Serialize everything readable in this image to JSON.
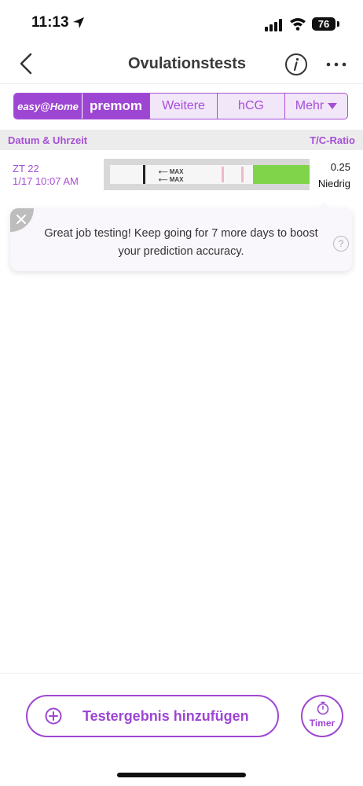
{
  "status_bar": {
    "time": "11:13",
    "battery": "76"
  },
  "nav": {
    "title": "Ovulationstests"
  },
  "brand_tabs": [
    {
      "label": "easy@Home"
    },
    {
      "label": "premom"
    },
    {
      "label": "Weitere"
    },
    {
      "label": "hCG"
    },
    {
      "label": "Mehr"
    }
  ],
  "table": {
    "header_left": "Datum & Uhrzeit",
    "header_right": "T/C-Ratio",
    "rows": [
      {
        "cycle_day": "ZT 22",
        "datetime": "1/17 10:07 AM",
        "ratio": "0.25",
        "level": "Niedrig",
        "strip_text_1": "MAX",
        "strip_text_2": "MAX"
      }
    ]
  },
  "tip": {
    "text": "Great job testing! Keep going for 7 more days to boost your prediction accuracy.",
    "help_glyph": "?"
  },
  "actions": {
    "add_label": "Testergebnis hinzufügen",
    "timer_label": "Timer"
  },
  "colors": {
    "accent": "#9d46d3",
    "strip_green": "#7fd44a"
  }
}
